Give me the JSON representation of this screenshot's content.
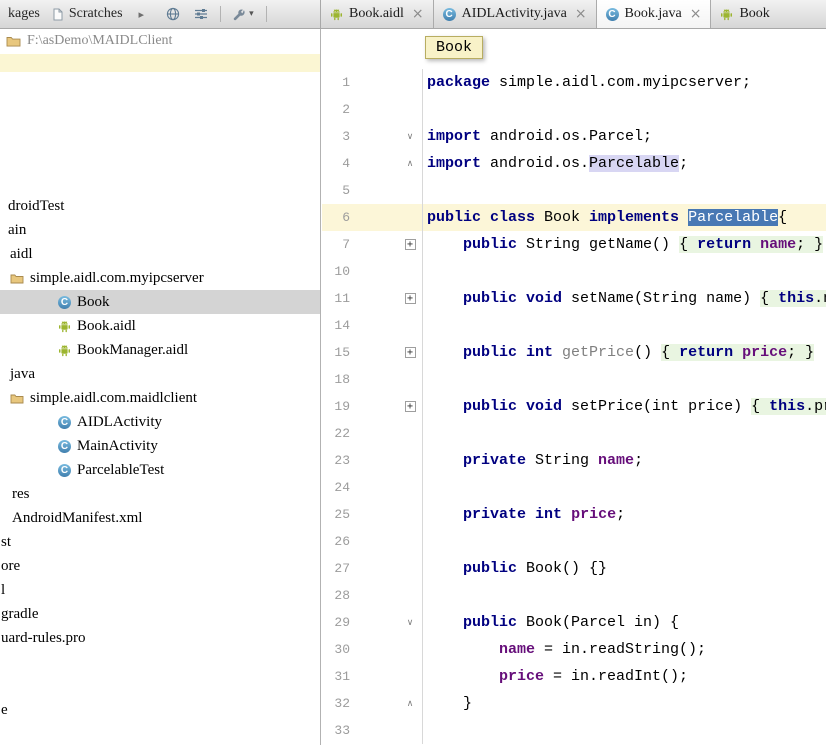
{
  "colors": {
    "kw": "#000080",
    "field": "#660E7A",
    "grayid": "#808080",
    "foldbg": "#E9F5E1",
    "identhl": "#D8D6F3",
    "selbg": "#4878B4",
    "caretline": "#FCF6D8",
    "band": "#FBF6D3",
    "treesel": "#D4D4D4"
  },
  "icons": {
    "close": "×",
    "fold_plus": "+",
    "fold_open": "∨",
    "fold_close": "∧",
    "hidden_tabs_chevron": "▸",
    "dropdown_caret": "▾"
  },
  "toolbar": {
    "packages_tab": "kages",
    "scratches_tab": "Scratches"
  },
  "project": {
    "path": "F:\\asDemo\\MAIDLClient",
    "tree": [
      {
        "label": "droidTest",
        "indent": 8
      },
      {
        "label": "ain",
        "indent": 8
      },
      {
        "label": "aidl",
        "indent": 10
      },
      {
        "label": "simple.aidl.com.myipcserver",
        "indent": 10,
        "icon": "package"
      },
      {
        "label": "Book",
        "indent": 58,
        "icon": "class",
        "selected": true
      },
      {
        "label": "Book.aidl",
        "indent": 58,
        "icon": "android"
      },
      {
        "label": "BookManager.aidl",
        "indent": 58,
        "icon": "android"
      },
      {
        "label": "java",
        "indent": 10
      },
      {
        "label": "simple.aidl.com.maidlclient",
        "indent": 10,
        "icon": "package"
      },
      {
        "label": "AIDLActivity",
        "indent": 58,
        "icon": "class"
      },
      {
        "label": "MainActivity",
        "indent": 58,
        "icon": "class"
      },
      {
        "label": "ParcelableTest",
        "indent": 58,
        "icon": "class"
      },
      {
        "label": "res",
        "indent": 12
      },
      {
        "label": "AndroidManifest.xml",
        "indent": 12
      },
      {
        "label": "st",
        "indent": 1
      },
      {
        "label": "ore",
        "indent": 1
      },
      {
        "label": "l",
        "indent": 1
      },
      {
        "label": "gradle",
        "indent": 1
      },
      {
        "label": "uard-rules.pro",
        "indent": 1
      },
      {
        "label": "",
        "indent": 1
      },
      {
        "label": "",
        "indent": 1
      },
      {
        "label": "e",
        "indent": 1
      },
      {
        "label": "",
        "indent": 1
      }
    ]
  },
  "editor_tabs": [
    {
      "label": "Book.aidl",
      "icon": "android",
      "closable": true,
      "active": false
    },
    {
      "label": "AIDLActivity.java",
      "icon": "class",
      "closable": true,
      "active": false
    },
    {
      "label": "Book.java",
      "icon": "class",
      "closable": true,
      "active": true
    },
    {
      "label": "Book",
      "icon": "android",
      "closable": false,
      "active": false
    }
  ],
  "editor": {
    "tooltip": "Book",
    "lines": [
      {
        "num": "1",
        "tokens": [
          {
            "t": "package",
            "c": "k"
          },
          {
            "t": " simple.aidl.com.myipcserver;",
            "c": "p"
          }
        ]
      },
      {
        "num": "2",
        "tokens": []
      },
      {
        "num": "3",
        "fold": "open",
        "tokens": [
          {
            "t": "import",
            "c": "k"
          },
          {
            "t": " android.os.Parcel;",
            "c": "p"
          }
        ]
      },
      {
        "num": "4",
        "fold": "close",
        "tokens": [
          {
            "t": "import",
            "c": "k"
          },
          {
            "t": " android.os.",
            "c": "p"
          },
          {
            "t": "Parcelable",
            "c": "p hl"
          },
          {
            "t": ";",
            "c": "p"
          }
        ]
      },
      {
        "num": "5",
        "tokens": []
      },
      {
        "num": "6",
        "caret": true,
        "tokens": [
          {
            "t": "public class",
            "c": "k"
          },
          {
            "t": " Book ",
            "c": "p"
          },
          {
            "t": "implements",
            "c": "k"
          },
          {
            "t": " ",
            "c": "p"
          },
          {
            "t": "Parcelable",
            "c": "p sel"
          },
          {
            "t": "{",
            "c": "p"
          }
        ]
      },
      {
        "num": "7",
        "fold": "plus",
        "tokens": [
          {
            "t": "    ",
            "c": "p"
          },
          {
            "t": "public",
            "c": "k"
          },
          {
            "t": " String getName() ",
            "c": "p"
          },
          {
            "t": "{ ",
            "c": "p fold"
          },
          {
            "t": "return",
            "c": "k fold"
          },
          {
            "t": " ",
            "c": "p fold"
          },
          {
            "t": "name",
            "c": "f fold"
          },
          {
            "t": "; }",
            "c": "p fold"
          }
        ]
      },
      {
        "num": "10",
        "tokens": []
      },
      {
        "num": "11",
        "fold": "plus",
        "tokens": [
          {
            "t": "    ",
            "c": "p"
          },
          {
            "t": "public void",
            "c": "k"
          },
          {
            "t": " setName(String name) ",
            "c": "p"
          },
          {
            "t": "{ ",
            "c": "p fold"
          },
          {
            "t": "this",
            "c": "k fold"
          },
          {
            "t": ".name = name; }",
            "c": "p fold"
          }
        ]
      },
      {
        "num": "14",
        "tokens": []
      },
      {
        "num": "15",
        "fold": "plus",
        "tokens": [
          {
            "t": "    ",
            "c": "p"
          },
          {
            "t": "public int",
            "c": "k"
          },
          {
            "t": " ",
            "c": "p"
          },
          {
            "t": "getPrice",
            "c": "g"
          },
          {
            "t": "() ",
            "c": "p"
          },
          {
            "t": "{ ",
            "c": "p fold"
          },
          {
            "t": "return",
            "c": "k fold"
          },
          {
            "t": " ",
            "c": "p fold"
          },
          {
            "t": "price",
            "c": "f fold"
          },
          {
            "t": "; }",
            "c": "p fold"
          }
        ]
      },
      {
        "num": "18",
        "tokens": []
      },
      {
        "num": "19",
        "fold": "plus",
        "tokens": [
          {
            "t": "    ",
            "c": "p"
          },
          {
            "t": "public void",
            "c": "k"
          },
          {
            "t": " setPrice(int price) ",
            "c": "p"
          },
          {
            "t": "{ ",
            "c": "p fold"
          },
          {
            "t": "this",
            "c": "k fold"
          },
          {
            "t": ".price = price; }",
            "c": "p fold"
          }
        ]
      },
      {
        "num": "22",
        "tokens": []
      },
      {
        "num": "23",
        "tokens": [
          {
            "t": "    ",
            "c": "p"
          },
          {
            "t": "private",
            "c": "k"
          },
          {
            "t": " String ",
            "c": "p"
          },
          {
            "t": "name",
            "c": "f"
          },
          {
            "t": ";",
            "c": "p"
          }
        ]
      },
      {
        "num": "24",
        "tokens": []
      },
      {
        "num": "25",
        "tokens": [
          {
            "t": "    ",
            "c": "p"
          },
          {
            "t": "private int",
            "c": "k"
          },
          {
            "t": " ",
            "c": "p"
          },
          {
            "t": "price",
            "c": "f"
          },
          {
            "t": ";",
            "c": "p"
          }
        ]
      },
      {
        "num": "26",
        "tokens": []
      },
      {
        "num": "27",
        "tokens": [
          {
            "t": "    ",
            "c": "p"
          },
          {
            "t": "public",
            "c": "k"
          },
          {
            "t": " Book() {}",
            "c": "p"
          }
        ]
      },
      {
        "num": "28",
        "tokens": []
      },
      {
        "num": "29",
        "fold": "open",
        "tokens": [
          {
            "t": "    ",
            "c": "p"
          },
          {
            "t": "public",
            "c": "k"
          },
          {
            "t": " Book(Parcel in) {",
            "c": "p"
          }
        ]
      },
      {
        "num": "30",
        "tokens": [
          {
            "t": "        ",
            "c": "p"
          },
          {
            "t": "name",
            "c": "f"
          },
          {
            "t": " = in.readString();",
            "c": "p"
          }
        ]
      },
      {
        "num": "31",
        "tokens": [
          {
            "t": "        ",
            "c": "p"
          },
          {
            "t": "price",
            "c": "f"
          },
          {
            "t": " = in.readInt();",
            "c": "p"
          }
        ]
      },
      {
        "num": "32",
        "fold": "close",
        "tokens": [
          {
            "t": "    }",
            "c": "p"
          }
        ]
      },
      {
        "num": "33",
        "tokens": []
      }
    ]
  }
}
